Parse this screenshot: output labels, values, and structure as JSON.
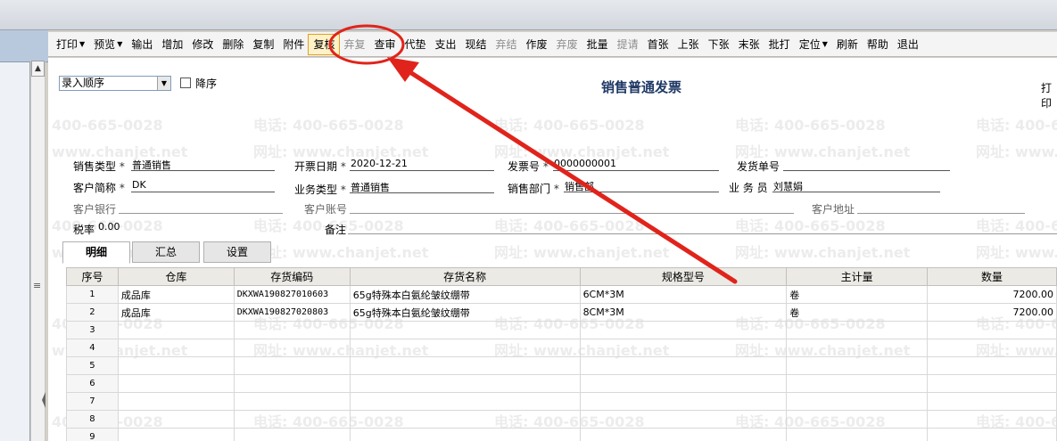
{
  "toolbar": {
    "items": [
      {
        "label": "打印",
        "dropdown": true,
        "disabled": false
      },
      {
        "label": "预览",
        "dropdown": true,
        "disabled": false
      },
      {
        "label": "输出",
        "dropdown": false,
        "disabled": false
      },
      {
        "label": "增加",
        "dropdown": false,
        "disabled": false
      },
      {
        "label": "修改",
        "dropdown": false,
        "disabled": false
      },
      {
        "label": "删除",
        "dropdown": false,
        "disabled": false
      },
      {
        "label": "复制",
        "dropdown": false,
        "disabled": false
      },
      {
        "label": "附件",
        "dropdown": false,
        "disabled": false
      },
      {
        "label": "复核",
        "dropdown": false,
        "disabled": false,
        "highlight": true
      },
      {
        "label": "弃复",
        "dropdown": false,
        "disabled": true
      },
      {
        "label": "查审",
        "dropdown": false,
        "disabled": false
      },
      {
        "label": "代垫",
        "dropdown": false,
        "disabled": false
      },
      {
        "label": "支出",
        "dropdown": false,
        "disabled": false
      },
      {
        "label": "现结",
        "dropdown": false,
        "disabled": false
      },
      {
        "label": "弃结",
        "dropdown": false,
        "disabled": true
      },
      {
        "label": "作废",
        "dropdown": false,
        "disabled": false
      },
      {
        "label": "弃废",
        "dropdown": false,
        "disabled": true
      },
      {
        "label": "批量",
        "dropdown": false,
        "disabled": false
      },
      {
        "label": "提请",
        "dropdown": false,
        "disabled": true
      },
      {
        "label": "首张",
        "dropdown": false,
        "disabled": false
      },
      {
        "label": "上张",
        "dropdown": false,
        "disabled": false
      },
      {
        "label": "下张",
        "dropdown": false,
        "disabled": false
      },
      {
        "label": "末张",
        "dropdown": false,
        "disabled": false
      },
      {
        "label": "批打",
        "dropdown": false,
        "disabled": false
      },
      {
        "label": "定位",
        "dropdown": true,
        "disabled": false
      },
      {
        "label": "刷新",
        "dropdown": false,
        "disabled": false
      },
      {
        "label": "帮助",
        "dropdown": false,
        "disabled": false
      },
      {
        "label": "退出",
        "dropdown": false,
        "disabled": false
      }
    ]
  },
  "form": {
    "title": "销售普通发票",
    "print_template_label": "打印",
    "sort_select_value": "录入顺序",
    "desc_label": "降序",
    "required_mark": "*",
    "fields": {
      "sales_type_label": "销售类型",
      "sales_type_value": "普通销售",
      "invoice_date_label": "开票日期",
      "invoice_date_value": "2020-12-21",
      "invoice_no_label": "发票号",
      "invoice_no_value": "0000000001",
      "delivery_no_label": "发货单号",
      "delivery_no_value": "",
      "customer_label": "客户简称",
      "customer_value": "DK",
      "business_type_label": "业务类型",
      "business_type_value": "普通销售",
      "sales_dept_label": "销售部门",
      "sales_dept_value": "销售部",
      "salesperson_label": "业 务 员",
      "salesperson_value": "刘慧娟",
      "customer_bank_label": "客户银行",
      "customer_account_label": "客户账号",
      "customer_address_label": "客户地址",
      "tax_rate_label": "税率",
      "tax_rate_value": "0.00",
      "remarks_label": "备注"
    }
  },
  "tabs": [
    {
      "label": "明细",
      "active": true
    },
    {
      "label": "汇总",
      "active": false
    },
    {
      "label": "设置",
      "active": false
    }
  ],
  "grid": {
    "columns": [
      "序号",
      "仓库",
      "存货编码",
      "存货名称",
      "规格型号",
      "主计量",
      "数量"
    ],
    "rows": [
      {
        "no": "1",
        "warehouse": "成品库",
        "code": "DKXWA190827010603",
        "name": "65g特殊本白氨纶皱纹绷带",
        "spec": "6CM*3M",
        "unit": "卷",
        "qty": "7200.00"
      },
      {
        "no": "2",
        "warehouse": "成品库",
        "code": "DKXWA190827020803",
        "name": "65g特殊本白氨纶皱纹绷带",
        "spec": "8CM*3M",
        "unit": "卷",
        "qty": "7200.00"
      },
      {
        "no": "3",
        "warehouse": "",
        "code": "",
        "name": "",
        "spec": "",
        "unit": "",
        "qty": ""
      },
      {
        "no": "4",
        "warehouse": "",
        "code": "",
        "name": "",
        "spec": "",
        "unit": "",
        "qty": ""
      },
      {
        "no": "5",
        "warehouse": "",
        "code": "",
        "name": "",
        "spec": "",
        "unit": "",
        "qty": ""
      },
      {
        "no": "6",
        "warehouse": "",
        "code": "",
        "name": "",
        "spec": "",
        "unit": "",
        "qty": ""
      },
      {
        "no": "7",
        "warehouse": "",
        "code": "",
        "name": "",
        "spec": "",
        "unit": "",
        "qty": ""
      },
      {
        "no": "8",
        "warehouse": "",
        "code": "",
        "name": "",
        "spec": "",
        "unit": "",
        "qty": ""
      },
      {
        "no": "9",
        "warehouse": "",
        "code": "",
        "name": "",
        "spec": "",
        "unit": "",
        "qty": ""
      }
    ]
  },
  "watermark": {
    "phone": "电话: 400-665-0028",
    "site": "网址: www.chanjet.net"
  },
  "annotation": {
    "color": "#e0241b"
  }
}
